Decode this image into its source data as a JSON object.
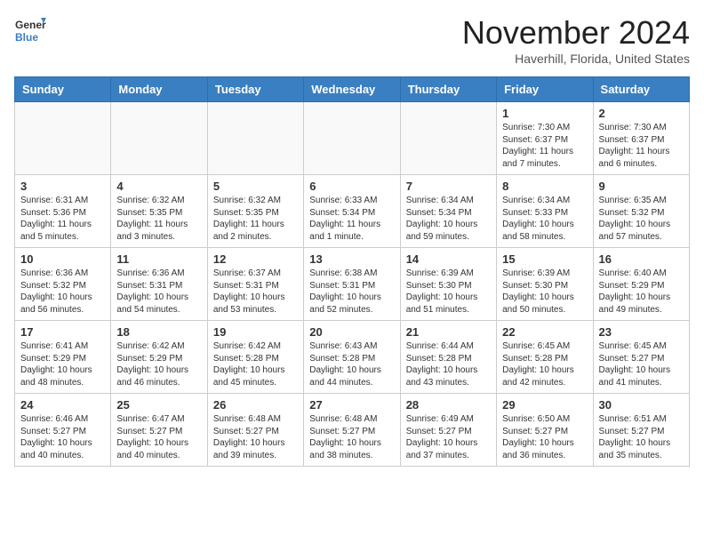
{
  "header": {
    "logo_line1": "General",
    "logo_line2": "Blue",
    "month_title": "November 2024",
    "location": "Haverhill, Florida, United States"
  },
  "days_of_week": [
    "Sunday",
    "Monday",
    "Tuesday",
    "Wednesday",
    "Thursday",
    "Friday",
    "Saturday"
  ],
  "weeks": [
    [
      {
        "day": "",
        "info": ""
      },
      {
        "day": "",
        "info": ""
      },
      {
        "day": "",
        "info": ""
      },
      {
        "day": "",
        "info": ""
      },
      {
        "day": "",
        "info": ""
      },
      {
        "day": "1",
        "info": "Sunrise: 7:30 AM\nSunset: 6:37 PM\nDaylight: 11 hours and 7 minutes."
      },
      {
        "day": "2",
        "info": "Sunrise: 7:30 AM\nSunset: 6:37 PM\nDaylight: 11 hours and 6 minutes."
      }
    ],
    [
      {
        "day": "3",
        "info": "Sunrise: 6:31 AM\nSunset: 5:36 PM\nDaylight: 11 hours and 5 minutes."
      },
      {
        "day": "4",
        "info": "Sunrise: 6:32 AM\nSunset: 5:35 PM\nDaylight: 11 hours and 3 minutes."
      },
      {
        "day": "5",
        "info": "Sunrise: 6:32 AM\nSunset: 5:35 PM\nDaylight: 11 hours and 2 minutes."
      },
      {
        "day": "6",
        "info": "Sunrise: 6:33 AM\nSunset: 5:34 PM\nDaylight: 11 hours and 1 minute."
      },
      {
        "day": "7",
        "info": "Sunrise: 6:34 AM\nSunset: 5:34 PM\nDaylight: 10 hours and 59 minutes."
      },
      {
        "day": "8",
        "info": "Sunrise: 6:34 AM\nSunset: 5:33 PM\nDaylight: 10 hours and 58 minutes."
      },
      {
        "day": "9",
        "info": "Sunrise: 6:35 AM\nSunset: 5:32 PM\nDaylight: 10 hours and 57 minutes."
      }
    ],
    [
      {
        "day": "10",
        "info": "Sunrise: 6:36 AM\nSunset: 5:32 PM\nDaylight: 10 hours and 56 minutes."
      },
      {
        "day": "11",
        "info": "Sunrise: 6:36 AM\nSunset: 5:31 PM\nDaylight: 10 hours and 54 minutes."
      },
      {
        "day": "12",
        "info": "Sunrise: 6:37 AM\nSunset: 5:31 PM\nDaylight: 10 hours and 53 minutes."
      },
      {
        "day": "13",
        "info": "Sunrise: 6:38 AM\nSunset: 5:31 PM\nDaylight: 10 hours and 52 minutes."
      },
      {
        "day": "14",
        "info": "Sunrise: 6:39 AM\nSunset: 5:30 PM\nDaylight: 10 hours and 51 minutes."
      },
      {
        "day": "15",
        "info": "Sunrise: 6:39 AM\nSunset: 5:30 PM\nDaylight: 10 hours and 50 minutes."
      },
      {
        "day": "16",
        "info": "Sunrise: 6:40 AM\nSunset: 5:29 PM\nDaylight: 10 hours and 49 minutes."
      }
    ],
    [
      {
        "day": "17",
        "info": "Sunrise: 6:41 AM\nSunset: 5:29 PM\nDaylight: 10 hours and 48 minutes."
      },
      {
        "day": "18",
        "info": "Sunrise: 6:42 AM\nSunset: 5:29 PM\nDaylight: 10 hours and 46 minutes."
      },
      {
        "day": "19",
        "info": "Sunrise: 6:42 AM\nSunset: 5:28 PM\nDaylight: 10 hours and 45 minutes."
      },
      {
        "day": "20",
        "info": "Sunrise: 6:43 AM\nSunset: 5:28 PM\nDaylight: 10 hours and 44 minutes."
      },
      {
        "day": "21",
        "info": "Sunrise: 6:44 AM\nSunset: 5:28 PM\nDaylight: 10 hours and 43 minutes."
      },
      {
        "day": "22",
        "info": "Sunrise: 6:45 AM\nSunset: 5:28 PM\nDaylight: 10 hours and 42 minutes."
      },
      {
        "day": "23",
        "info": "Sunrise: 6:45 AM\nSunset: 5:27 PM\nDaylight: 10 hours and 41 minutes."
      }
    ],
    [
      {
        "day": "24",
        "info": "Sunrise: 6:46 AM\nSunset: 5:27 PM\nDaylight: 10 hours and 40 minutes."
      },
      {
        "day": "25",
        "info": "Sunrise: 6:47 AM\nSunset: 5:27 PM\nDaylight: 10 hours and 40 minutes."
      },
      {
        "day": "26",
        "info": "Sunrise: 6:48 AM\nSunset: 5:27 PM\nDaylight: 10 hours and 39 minutes."
      },
      {
        "day": "27",
        "info": "Sunrise: 6:48 AM\nSunset: 5:27 PM\nDaylight: 10 hours and 38 minutes."
      },
      {
        "day": "28",
        "info": "Sunrise: 6:49 AM\nSunset: 5:27 PM\nDaylight: 10 hours and 37 minutes."
      },
      {
        "day": "29",
        "info": "Sunrise: 6:50 AM\nSunset: 5:27 PM\nDaylight: 10 hours and 36 minutes."
      },
      {
        "day": "30",
        "info": "Sunrise: 6:51 AM\nSunset: 5:27 PM\nDaylight: 10 hours and 35 minutes."
      }
    ]
  ]
}
